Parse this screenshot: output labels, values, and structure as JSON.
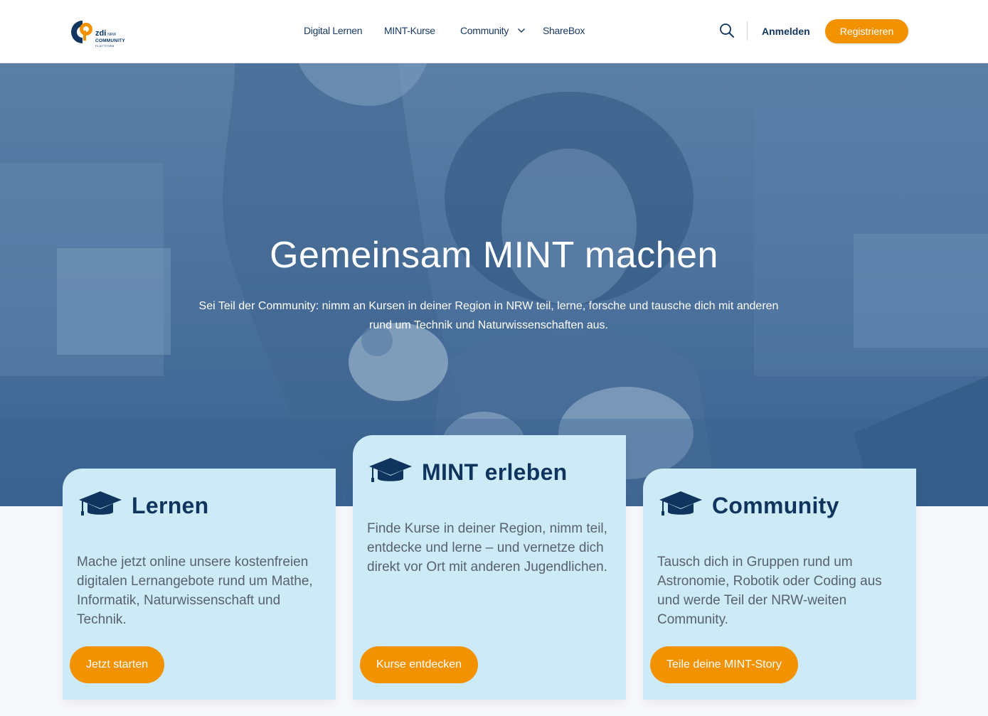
{
  "header": {
    "logo": {
      "zdi": "zdi",
      "nrw": "NRW",
      "community": "COMMUNITY",
      "plattform": "PLATTFORM"
    },
    "nav": [
      {
        "label": "Digital Lernen"
      },
      {
        "label": "MINT-Kurse"
      },
      {
        "label": "Community",
        "has_dropdown": true
      },
      {
        "label": "ShareBox"
      }
    ],
    "search_icon": "search-icon",
    "login_label": "Anmelden",
    "register_label": "Registrieren"
  },
  "hero": {
    "title": "Gemeinsam MINT machen",
    "subtitle": "Sei Teil der Community: nimm an Kursen in deiner Region in NRW teil, lerne, forsche und tausche dich mit anderen rund um Technik und Naturwissenschaften aus."
  },
  "cards": [
    {
      "icon": "graduation-cap-icon",
      "title": "Lernen",
      "text": "Mache jetzt online unsere kostenfreien digitalen Lernangebote rund um Mathe, Informatik, Naturwissenschaft und Technik.",
      "button": "Jetzt starten"
    },
    {
      "icon": "graduation-cap-icon",
      "title": "MINT erleben",
      "text": "Finde Kurse in deiner Region, nimm teil, entdecke und lerne – und vernetze dich direkt vor Ort mit anderen Jugendlichen.",
      "button": "Kurse entdecken"
    },
    {
      "icon": "graduation-cap-icon",
      "title": "Community",
      "text": "Tausch dich in Gruppen rund um Astronomie, Robotik oder Coding aus und werde Teil der NRW-weiten Community.",
      "button": "Teile deine MINT-Story"
    }
  ],
  "colors": {
    "accent": "#f39200",
    "primary": "#0f355f",
    "card_bg": "#cdeaf7",
    "hero_overlay": "#4a6f9b"
  }
}
